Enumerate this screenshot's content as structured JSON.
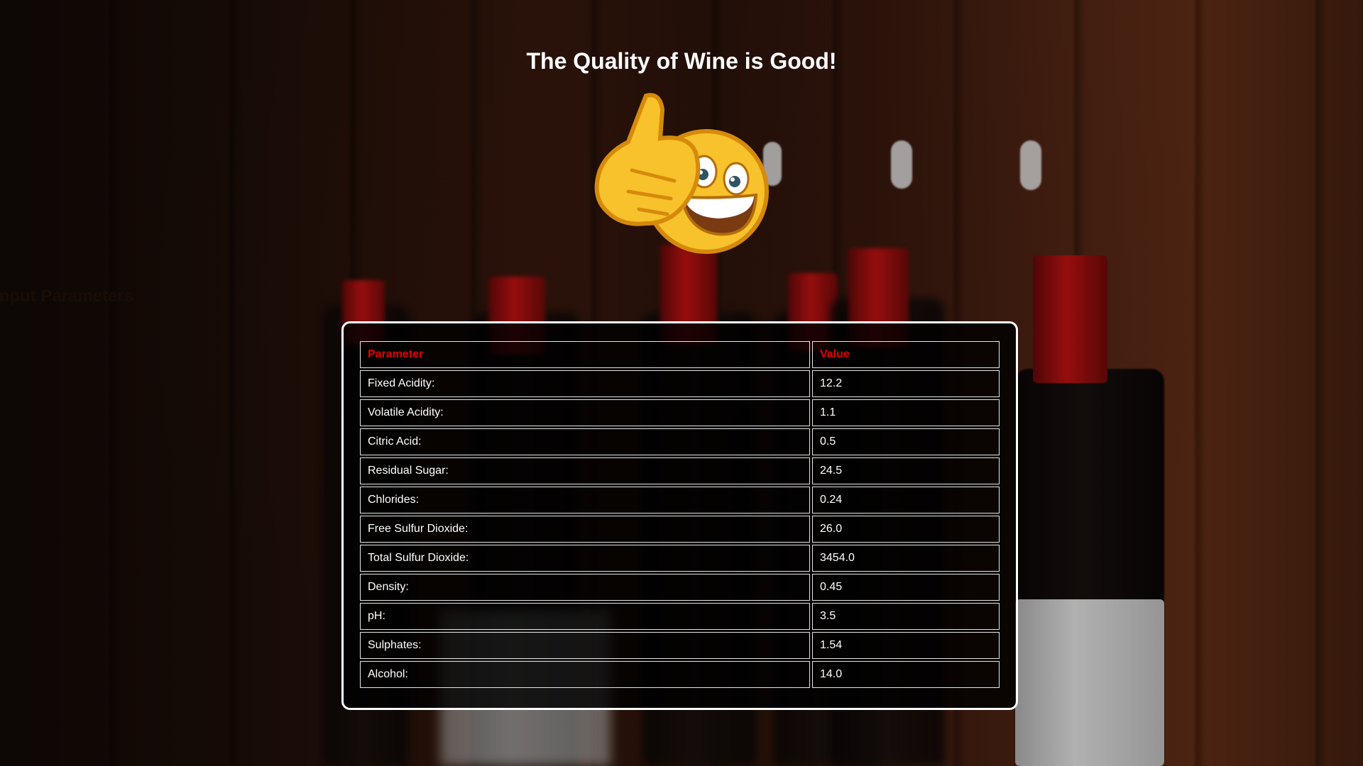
{
  "title": "The Quality of Wine is Good!",
  "emoji": "thumbs-up-grinning-emoji",
  "side_heading": "Input Parameters",
  "table": {
    "headers": {
      "parameter": "Parameter",
      "value": "Value"
    },
    "rows": [
      {
        "label": "Fixed Acidity:",
        "value": "12.2"
      },
      {
        "label": "Volatile Acidity:",
        "value": "1.1"
      },
      {
        "label": "Citric Acid:",
        "value": "0.5"
      },
      {
        "label": "Residual Sugar:",
        "value": "24.5"
      },
      {
        "label": "Chlorides:",
        "value": "0.24"
      },
      {
        "label": "Free Sulfur Dioxide:",
        "value": "26.0"
      },
      {
        "label": "Total Sulfur Dioxide:",
        "value": "3454.0"
      },
      {
        "label": "Density:",
        "value": "0.45"
      },
      {
        "label": "pH:",
        "value": "3.5"
      },
      {
        "label": "Sulphates:",
        "value": "1.54"
      },
      {
        "label": "Alcohol:",
        "value": "14.0"
      }
    ]
  },
  "colors": {
    "header_text": "#e10000",
    "card_border": "#ffffff",
    "background": "#2c140b"
  }
}
